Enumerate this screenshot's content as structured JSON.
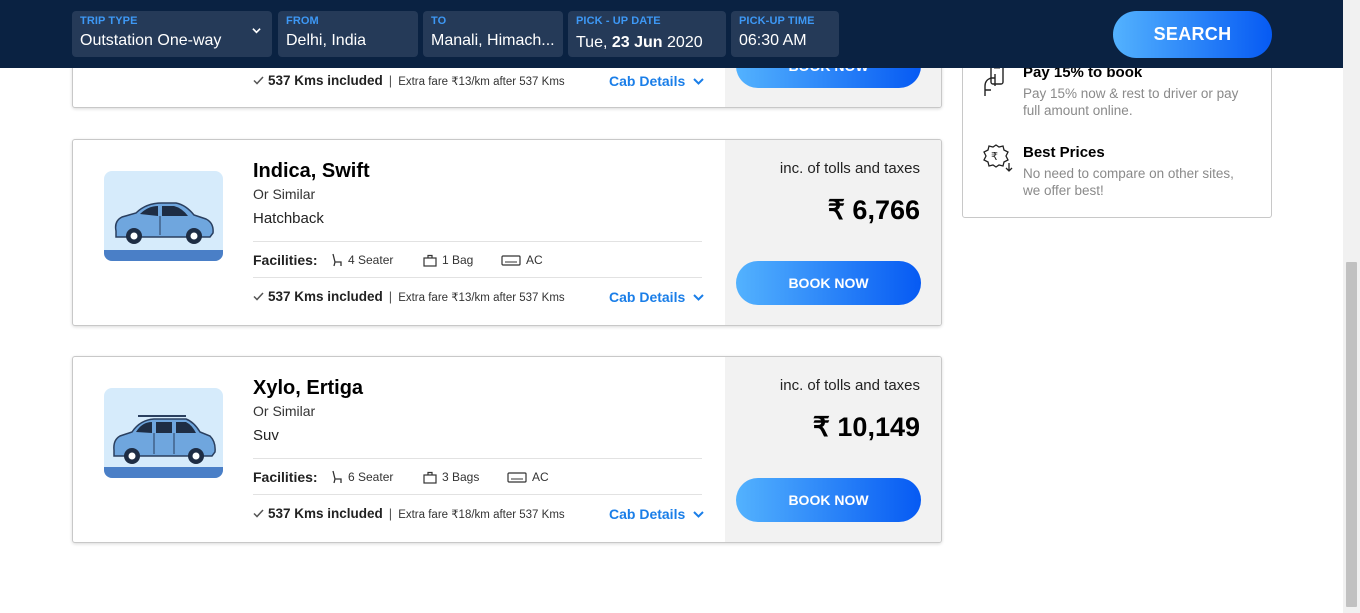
{
  "header": {
    "fields": [
      {
        "label": "TRIP TYPE",
        "value": "Outstation One-way"
      },
      {
        "label": "FROM",
        "value": "Delhi, India"
      },
      {
        "label": "TO",
        "value": "Manali, Himach..."
      },
      {
        "label": "PICK - UP DATE",
        "value_prefix": "Tue,",
        "value_bold": "23 Jun",
        "value_suffix": "2020"
      },
      {
        "label": "PICK-UP TIME",
        "value": "06:30 AM"
      }
    ],
    "search_label": "SEARCH"
  },
  "cards": [
    {
      "kms_included": "537 Kms included",
      "extra_fare": "Extra fare ₹13/km after 537 Kms",
      "cab_details": "Cab Details",
      "book_label": "BOOK NOW"
    },
    {
      "name": "Indica, Swift",
      "similar": "Or Similar",
      "type": "Hatchback",
      "facilities_label": "Facilities:",
      "seats": "4 Seater",
      "bags": "1 Bag",
      "ac": "AC",
      "kms_included": "537 Kms included",
      "extra_fare": "Extra fare ₹13/km after 537 Kms",
      "cab_details": "Cab Details",
      "incl": "inc. of tolls and taxes",
      "price": "₹ 6,766",
      "book_label": "BOOK NOW"
    },
    {
      "name": "Xylo, Ertiga",
      "similar": "Or Similar",
      "type": "Suv",
      "facilities_label": "Facilities:",
      "seats": "6 Seater",
      "bags": "3 Bags",
      "ac": "AC",
      "kms_included": "537 Kms included",
      "extra_fare": "Extra fare ₹18/km after 537 Kms",
      "cab_details": "Cab Details",
      "incl": "inc. of tolls and taxes",
      "price": "₹ 10,149",
      "book_label": "BOOK NOW"
    }
  ],
  "sidebar": {
    "items": [
      {
        "title": "Pay 15% to book",
        "desc": "Pay 15% now & rest to driver or pay full amount online.",
        "icon": "pay-hand-icon"
      },
      {
        "title": "Best Prices",
        "desc": "No need to compare on other sites, we offer best!",
        "icon": "best-price-icon"
      }
    ]
  },
  "colors": {
    "header_bg": "#0a2242",
    "field_bg": "#253a58",
    "label_blue": "#3d98f5",
    "button_gradient_start": "#53b2fe",
    "button_gradient_end": "#065af3",
    "link_blue": "#1a7ee8"
  }
}
